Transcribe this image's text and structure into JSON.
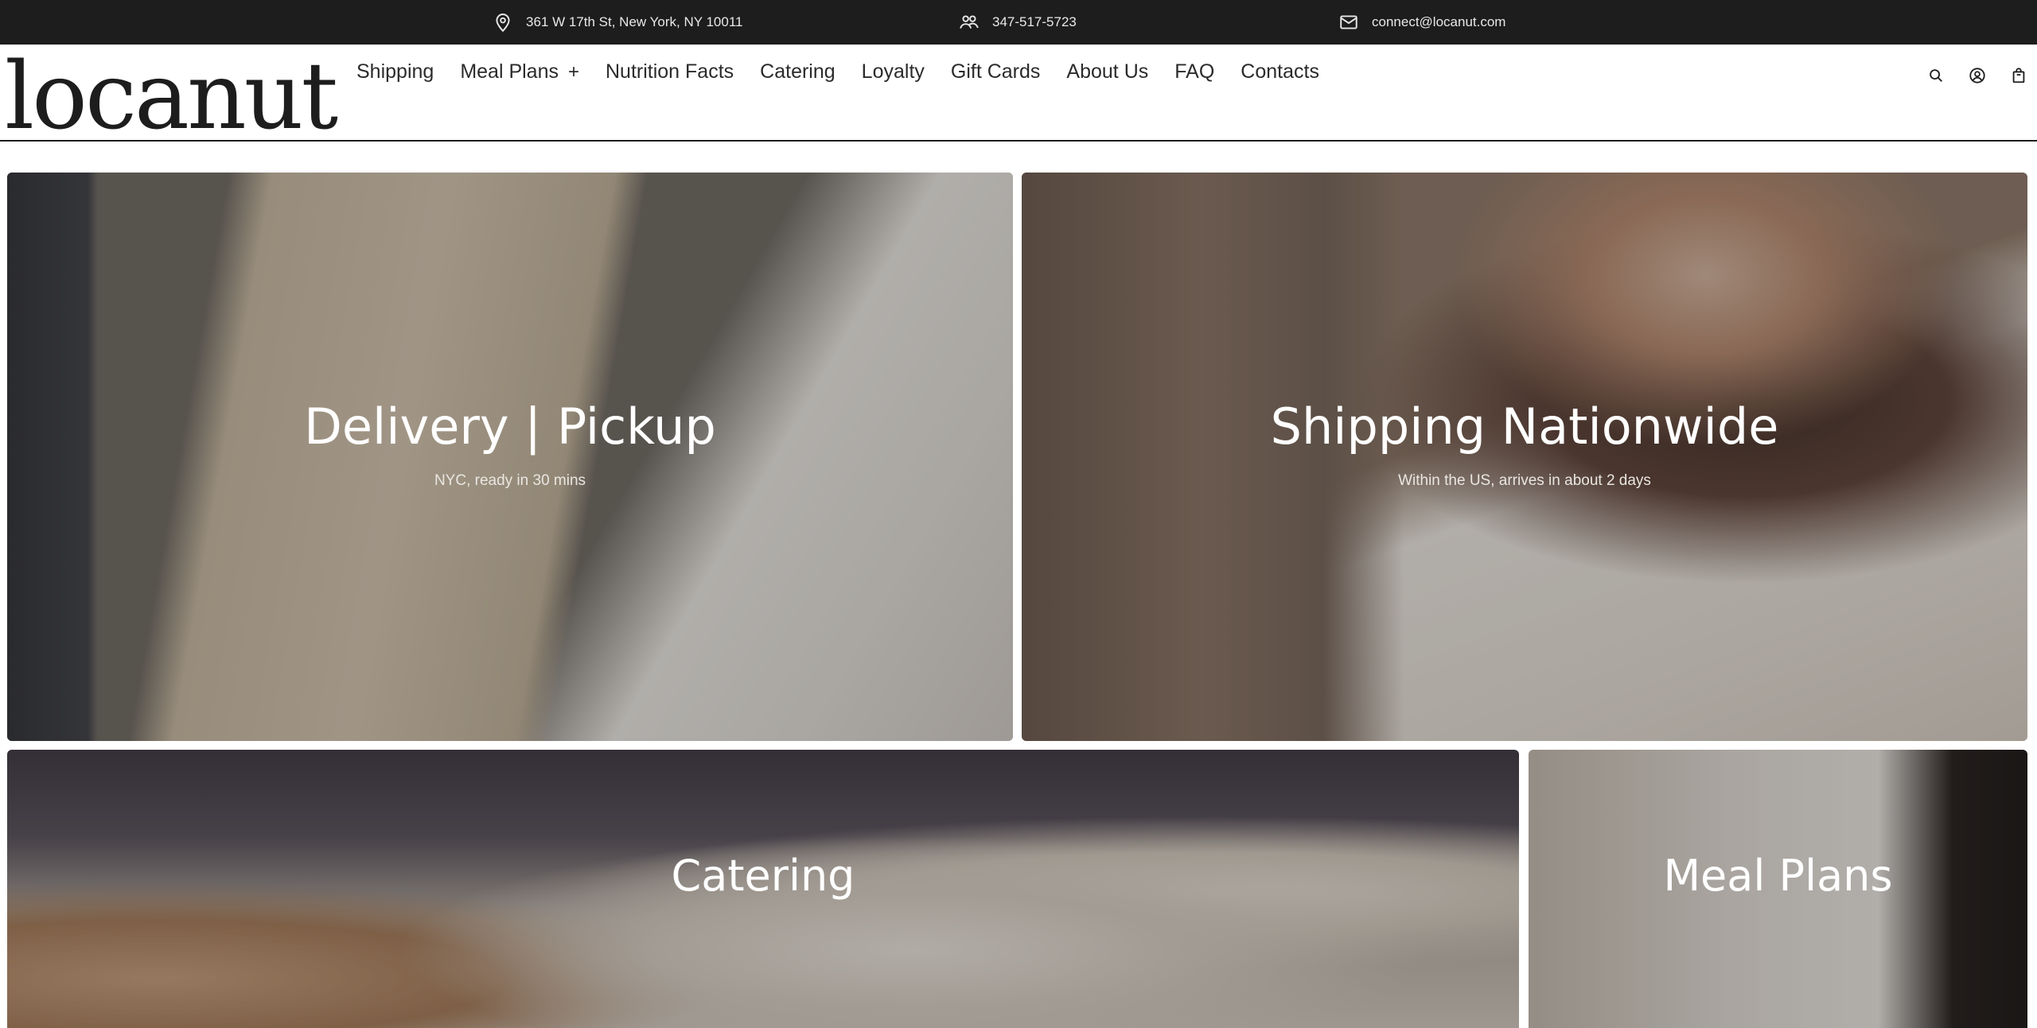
{
  "topbar": {
    "address": "361 W 17th St, New York, NY 10011",
    "phone": "347-517-5723",
    "email": "connect@locanut.com"
  },
  "header": {
    "logo": "locanut",
    "nav": [
      {
        "label": "Shipping"
      },
      {
        "label": "Meal Plans",
        "expandable": true,
        "expand_symbol": "+"
      },
      {
        "label": "Nutrition Facts"
      },
      {
        "label": "Catering"
      },
      {
        "label": "Loyalty"
      },
      {
        "label": "Gift Cards"
      },
      {
        "label": "About Us"
      },
      {
        "label": "FAQ"
      },
      {
        "label": "Contacts"
      }
    ],
    "icons": [
      "search-icon",
      "account-icon",
      "cart-icon"
    ]
  },
  "tiles": {
    "delivery": {
      "title": "Delivery | Pickup",
      "subtitle": "NYC, ready in 30 mins"
    },
    "shipping": {
      "title": "Shipping Nationwide",
      "subtitle": "Within the US, arrives in about 2 days"
    },
    "catering": {
      "title": "Catering"
    },
    "meal_plans": {
      "title": "Meal Plans"
    }
  },
  "colors": {
    "topbar_bg": "#1d1d1d",
    "text_dark": "#1d1d1f",
    "overlay_text": "#ffffff"
  }
}
